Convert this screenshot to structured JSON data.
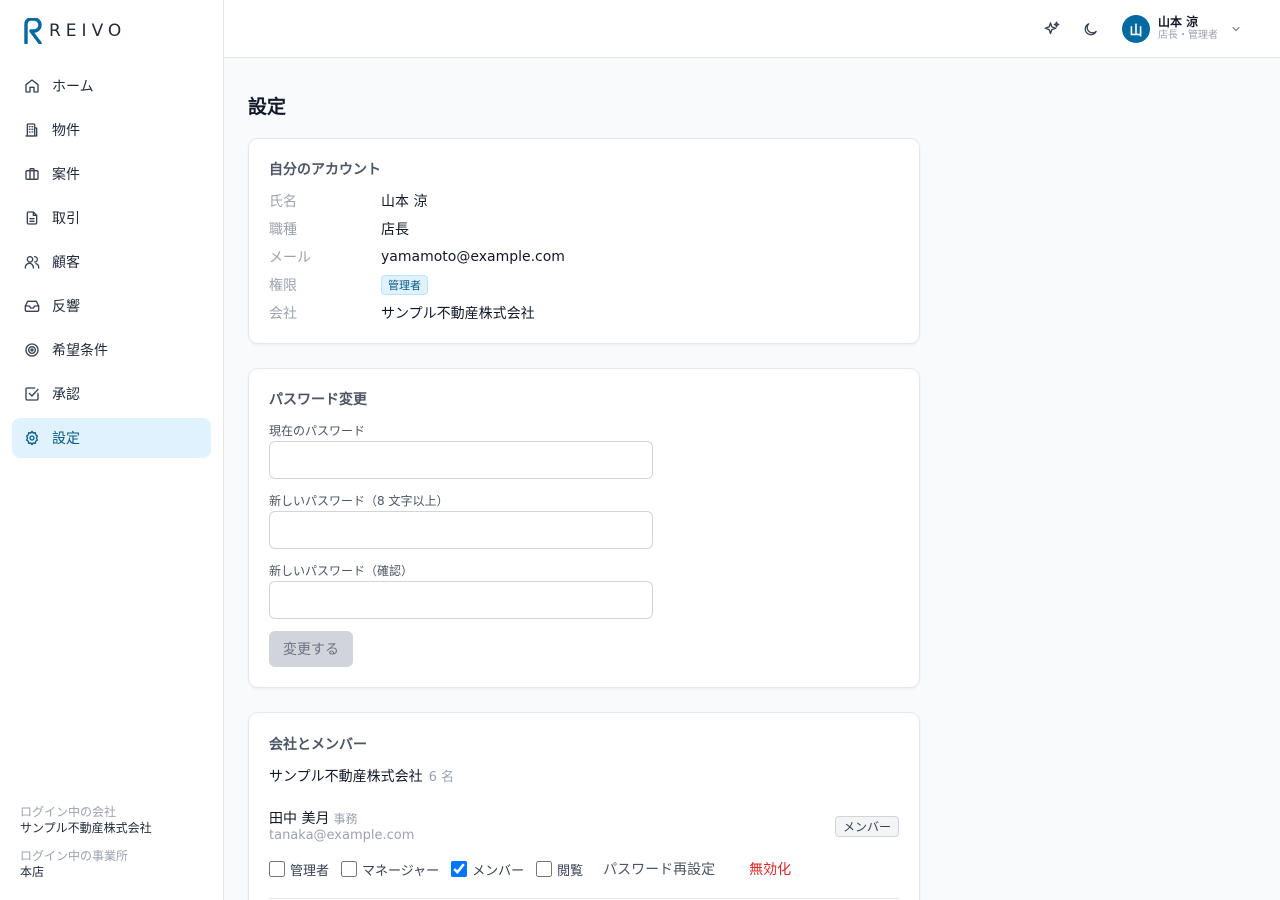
{
  "brand": {
    "name": "REIVO",
    "color": "#0369a1"
  },
  "nav": [
    {
      "label": "ホーム",
      "icon": "home-icon"
    },
    {
      "label": "物件",
      "icon": "building-icon"
    },
    {
      "label": "案件",
      "icon": "briefcase-icon"
    },
    {
      "label": "取引",
      "icon": "document-icon"
    },
    {
      "label": "顧客",
      "icon": "users-icon"
    },
    {
      "label": "反響",
      "icon": "inbox-icon"
    },
    {
      "label": "希望条件",
      "icon": "target-icon"
    },
    {
      "label": "承認",
      "icon": "checkbox-icon"
    },
    {
      "label": "設定",
      "icon": "gear-icon",
      "active": true
    }
  ],
  "sidebar_footer": {
    "company_label": "ログイン中の会社",
    "company": "サンプル不動産株式会社",
    "office_label": "ログイン中の事業所",
    "office": "本店"
  },
  "topbar": {
    "sparkle_icon": "sparkle-icon",
    "theme_icon": "moon-icon",
    "user": {
      "initial": "山",
      "name": "山本 涼",
      "role": "店長・管理者"
    }
  },
  "page_title": "設定",
  "account": {
    "title": "自分のアカウント",
    "name_label": "氏名",
    "name": "山本 涼",
    "job_label": "職種",
    "job": "店長",
    "email_label": "メール",
    "email": "yamamoto@example.com",
    "perm_label": "権限",
    "perm": "管理者",
    "company_label": "会社",
    "company": "サンプル不動産株式会社"
  },
  "password": {
    "title": "パスワード変更",
    "current_label": "現在のパスワード",
    "new_label": "新しいパスワード（8 文字以上）",
    "confirm_label": "新しいパスワード（確認）",
    "submit": "変更する"
  },
  "members": {
    "title": "会社とメンバー",
    "company": "サンプル不動産株式会社",
    "count": "6 名",
    "list": [
      {
        "name": "田中 美月",
        "role": "事務",
        "email": "tanaka@example.com",
        "badge": "メンバー",
        "perms": [
          {
            "label": "管理者",
            "checked": false
          },
          {
            "label": "マネージャー",
            "checked": false
          },
          {
            "label": "メンバー",
            "checked": true
          },
          {
            "label": "閲覧",
            "checked": false
          }
        ],
        "reset": "パスワード再設定",
        "disable": "無効化"
      }
    ]
  }
}
